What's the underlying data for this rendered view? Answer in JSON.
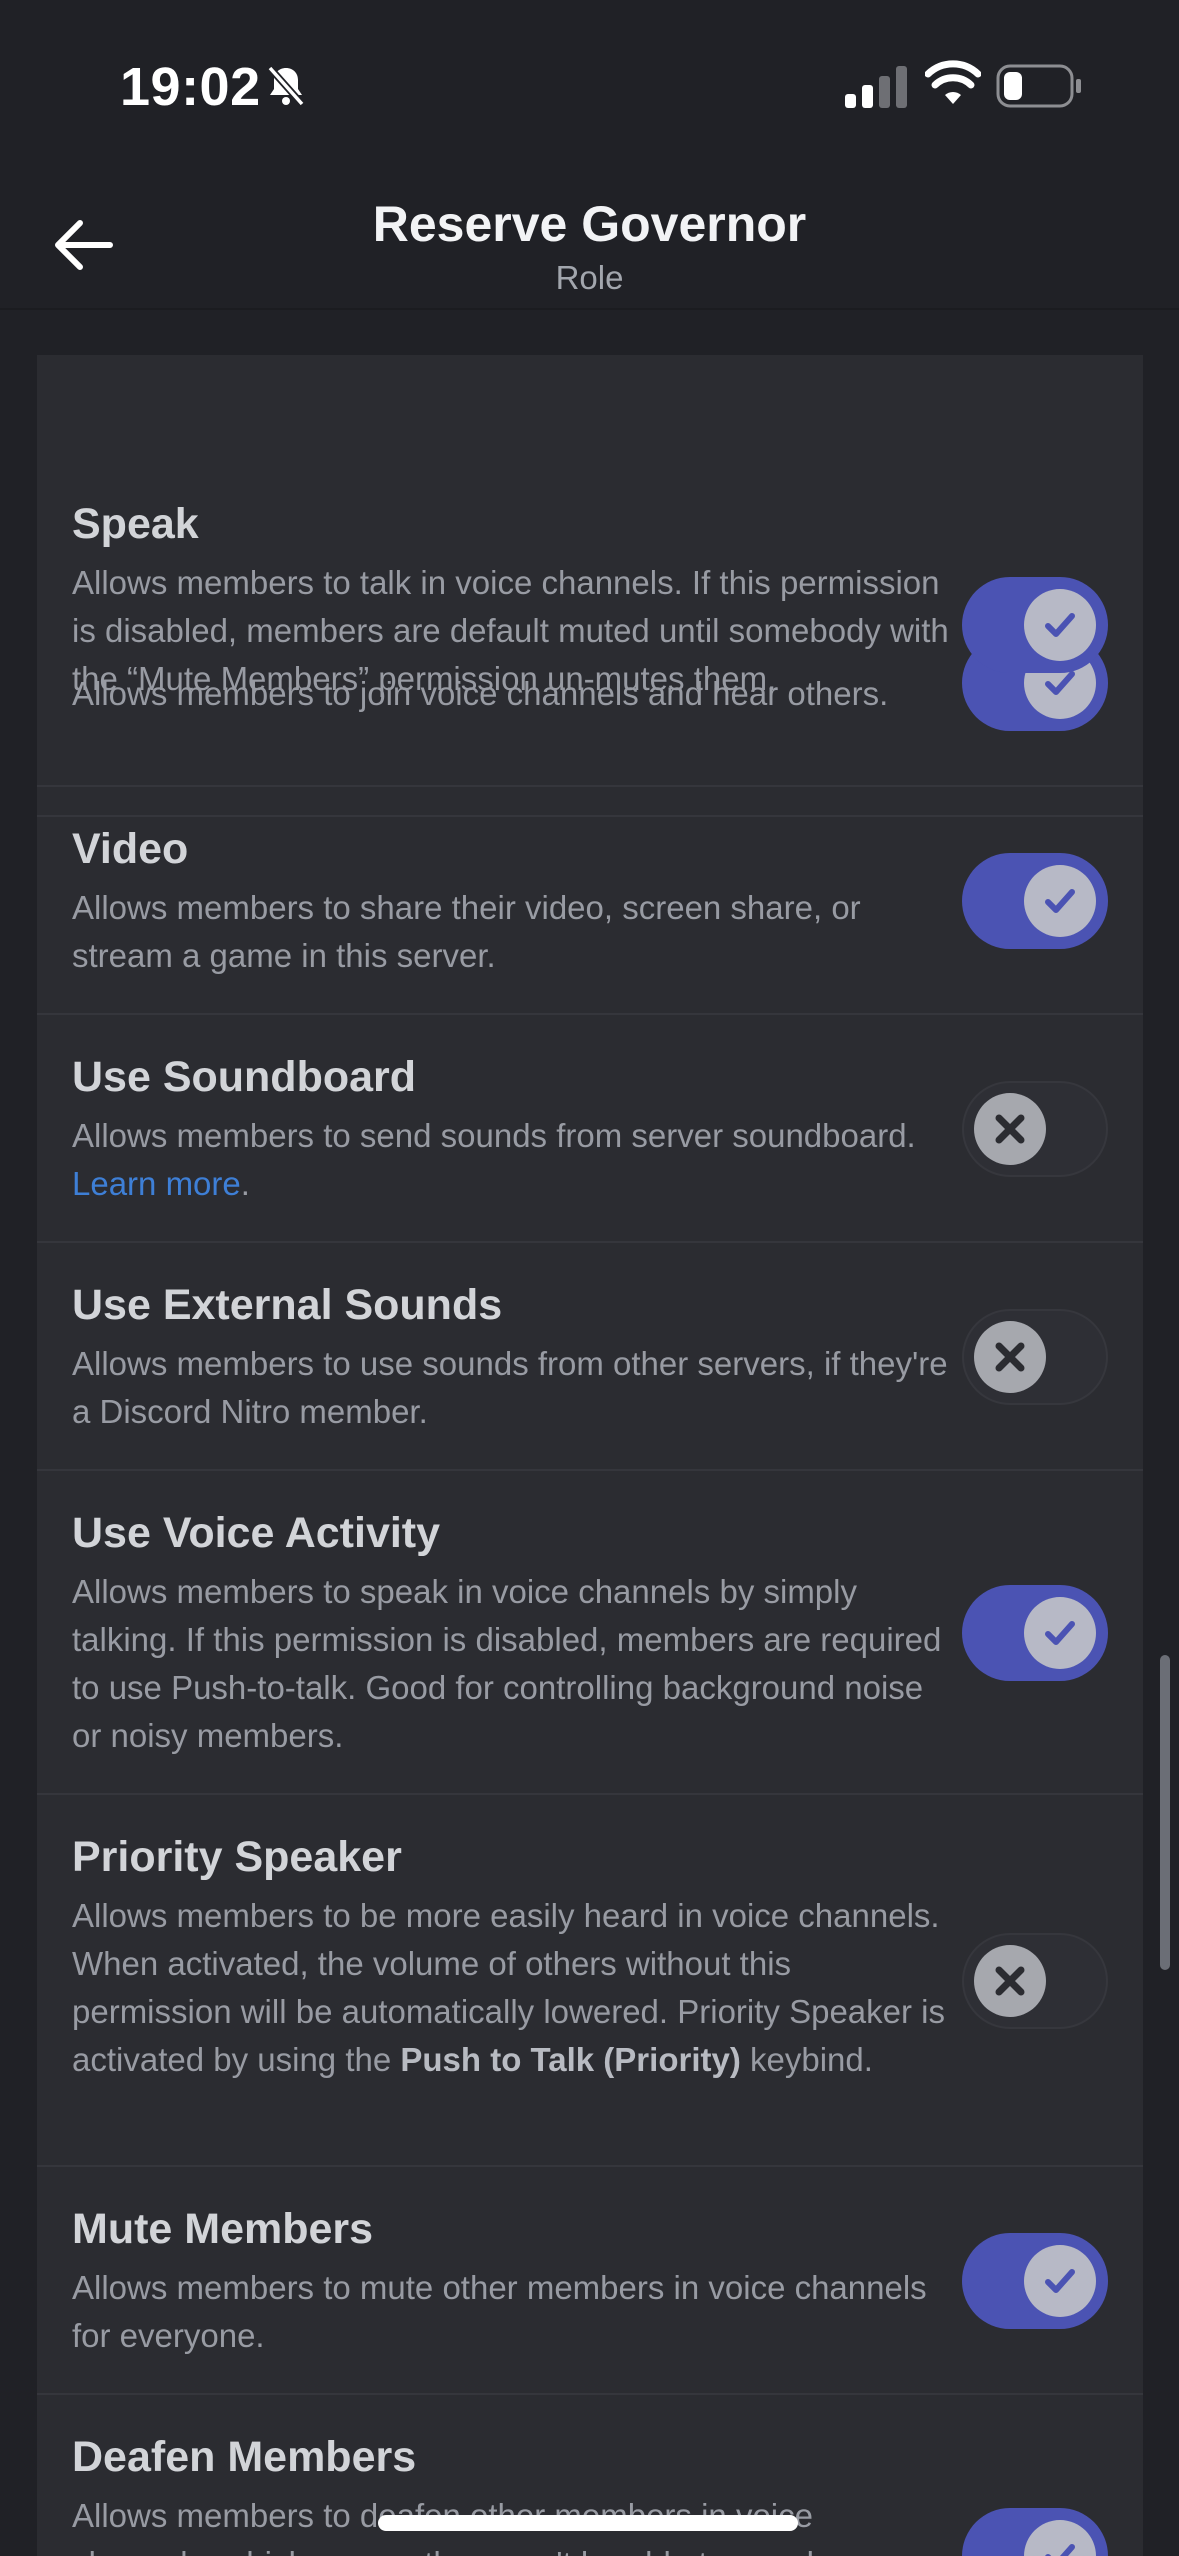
{
  "status_bar": {
    "time": "19:02"
  },
  "header": {
    "title": "Reserve Governor",
    "subtitle": "Role"
  },
  "permissions": [
    {
      "name": "",
      "description": "Allows members to join voice channels and hear others.",
      "enabled": true
    },
    {
      "name": "Speak",
      "description": "Allows members to talk in voice channels. If this permission is disabled, members are default muted until somebody with the “Mute Members” permission un-mutes them.",
      "enabled": true
    },
    {
      "name": "Video",
      "description": "Allows members to share their video, screen share, or stream a game in this server.",
      "enabled": true
    },
    {
      "name": "Use Soundboard",
      "description": "Allows members to send sounds from server soundboard.",
      "link": "Learn more",
      "link_suffix": ".",
      "enabled": false
    },
    {
      "name": "Use External Sounds",
      "description": "Allows members to use sounds from other servers, if they're a Discord Nitro member.",
      "enabled": false
    },
    {
      "name": "Use Voice Activity",
      "description": "Allows members to speak in voice channels by simply talking. If this permission is disabled, members are required to use Push-to-talk. Good for controlling background noise or noisy members.",
      "enabled": true
    },
    {
      "name": "Priority Speaker",
      "description_pre": "Allows members to be more easily heard in voice channels. When activated, the volume of others without this permission will be automatically lowered. Priority Speaker is activated by using the",
      "description_bold": "Push to Talk (Priority)",
      "description_post": "keybind.",
      "enabled": false
    },
    {
      "name": "Mute Members",
      "description": "Allows members to mute other members in voice channels for everyone.",
      "enabled": true
    },
    {
      "name": "Deafen Members",
      "description": "Allows members to deafen other members in voice channels, which means they won't be able to speak",
      "enabled": true
    }
  ],
  "colors": {
    "background": "#202126",
    "panel": "#2b2c31",
    "toggle_on": "#4b53b3",
    "link": "#3e7fd6"
  },
  "icons": {
    "back": "arrow-left-icon",
    "bell": "bell-slash-icon",
    "signal": "cellular-signal-icon",
    "wifi": "wifi-icon",
    "battery": "battery-icon",
    "check": "check-icon",
    "x": "x-icon"
  }
}
